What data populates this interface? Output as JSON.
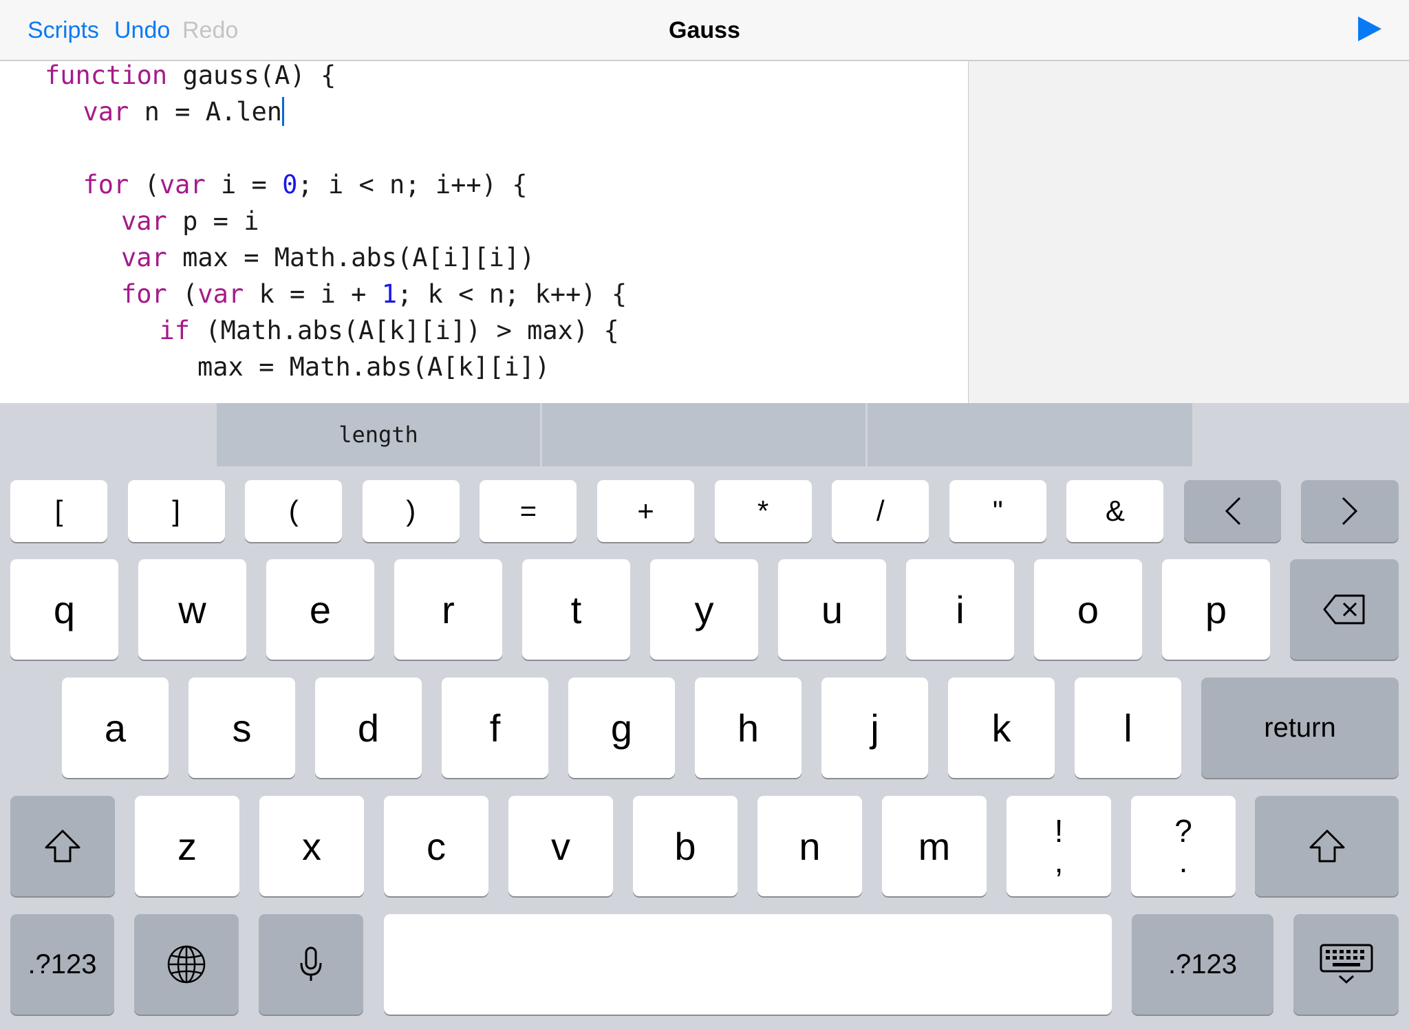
{
  "nav": {
    "scripts_label": "Scripts",
    "undo_label": "Undo",
    "redo_label": "Redo",
    "title": "Gauss",
    "run_icon": "play-icon",
    "accent_color": "#0a7af4"
  },
  "editor": {
    "lines": [
      {
        "indent": 0,
        "tokens": [
          {
            "t": "function",
            "c": "kw"
          },
          {
            "t": " gauss(A) {"
          }
        ]
      },
      {
        "indent": 1,
        "tokens": [
          {
            "t": "var",
            "c": "kw"
          },
          {
            "t": " n = A.len"
          }
        ],
        "caret": true
      },
      {
        "indent": 0,
        "tokens": []
      },
      {
        "indent": 1,
        "tokens": [
          {
            "t": "for",
            "c": "kw"
          },
          {
            "t": " ("
          },
          {
            "t": "var",
            "c": "kw"
          },
          {
            "t": " i = "
          },
          {
            "t": "0",
            "c": "num"
          },
          {
            "t": "; i < n; i++) {"
          }
        ]
      },
      {
        "indent": 2,
        "tokens": [
          {
            "t": "var",
            "c": "kw"
          },
          {
            "t": " p = i"
          }
        ]
      },
      {
        "indent": 2,
        "tokens": [
          {
            "t": "var",
            "c": "kw"
          },
          {
            "t": " max = Math.abs(A[i][i])"
          }
        ]
      },
      {
        "indent": 2,
        "tokens": [
          {
            "t": "for",
            "c": "kw"
          },
          {
            "t": " ("
          },
          {
            "t": "var",
            "c": "kw"
          },
          {
            "t": " k = i + "
          },
          {
            "t": "1",
            "c": "num"
          },
          {
            "t": "; k < n; k++) {"
          }
        ]
      },
      {
        "indent": 3,
        "tokens": [
          {
            "t": "if",
            "c": "kw"
          },
          {
            "t": " (Math.abs(A[k][i]) > max) {"
          }
        ]
      },
      {
        "indent": 4,
        "tokens": [
          {
            "t": "max = Math.abs(A[k][i])"
          }
        ]
      }
    ],
    "keyword_color": "#a51a8a",
    "number_color": "#1b17e8"
  },
  "keyboard": {
    "suggestions": [
      "length",
      "",
      ""
    ],
    "symbol_row": [
      "[",
      "]",
      "(",
      ")",
      "=",
      "+",
      "*",
      "/",
      "\"",
      "&"
    ],
    "cursor_left_icon": "chevron-left-icon",
    "cursor_right_icon": "chevron-right-icon",
    "row1": [
      "q",
      "w",
      "e",
      "r",
      "t",
      "y",
      "u",
      "i",
      "o",
      "p"
    ],
    "delete_icon": "backspace-icon",
    "row2": [
      "a",
      "s",
      "d",
      "f",
      "g",
      "h",
      "j",
      "k",
      "l"
    ],
    "return_label": "return",
    "shift_icon": "shift-icon",
    "row3": [
      "z",
      "x",
      "c",
      "v",
      "b",
      "n",
      "m"
    ],
    "punct_keys": [
      {
        "top": "!",
        "bottom": ","
      },
      {
        "top": "?",
        "bottom": "."
      }
    ],
    "numbers_label": ".?123",
    "globe_icon": "globe-icon",
    "mic_icon": "microphone-icon",
    "dismiss_icon": "keyboard-dismiss-icon"
  }
}
